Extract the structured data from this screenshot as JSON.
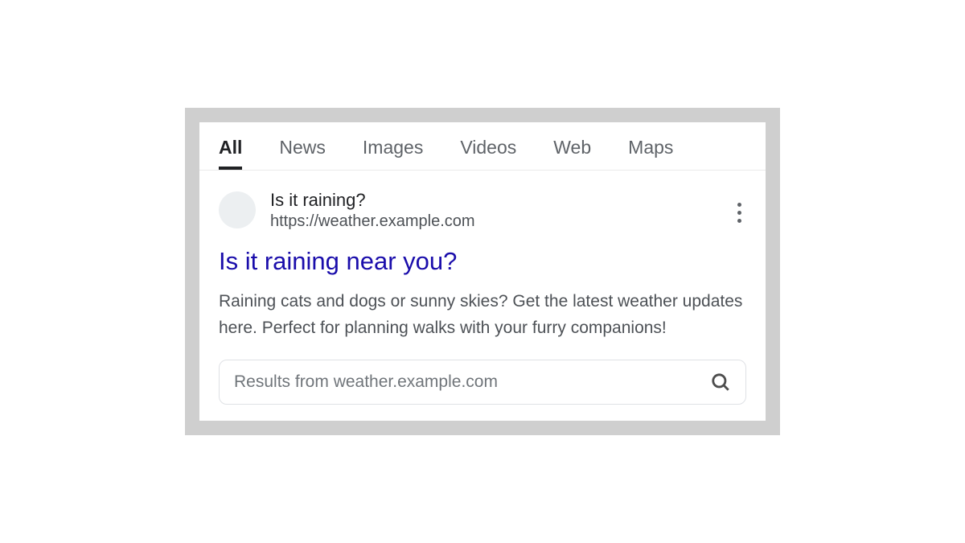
{
  "tabs": {
    "all": "All",
    "news": "News",
    "images": "Images",
    "videos": "Videos",
    "web": "Web",
    "maps": "Maps"
  },
  "result": {
    "site_name": "Is it raining?",
    "site_url": "https://weather.example.com",
    "title": "Is it raining near you?",
    "snippet": "Raining cats and dogs or sunny skies? Get the latest weather updates here. Perfect for planning walks with your furry companions!"
  },
  "sitelinks_search": {
    "placeholder": "Results from weather.example.com"
  },
  "colors": {
    "link_blue": "#1a0dab",
    "text_primary": "#202124",
    "text_secondary": "#5f6368"
  }
}
